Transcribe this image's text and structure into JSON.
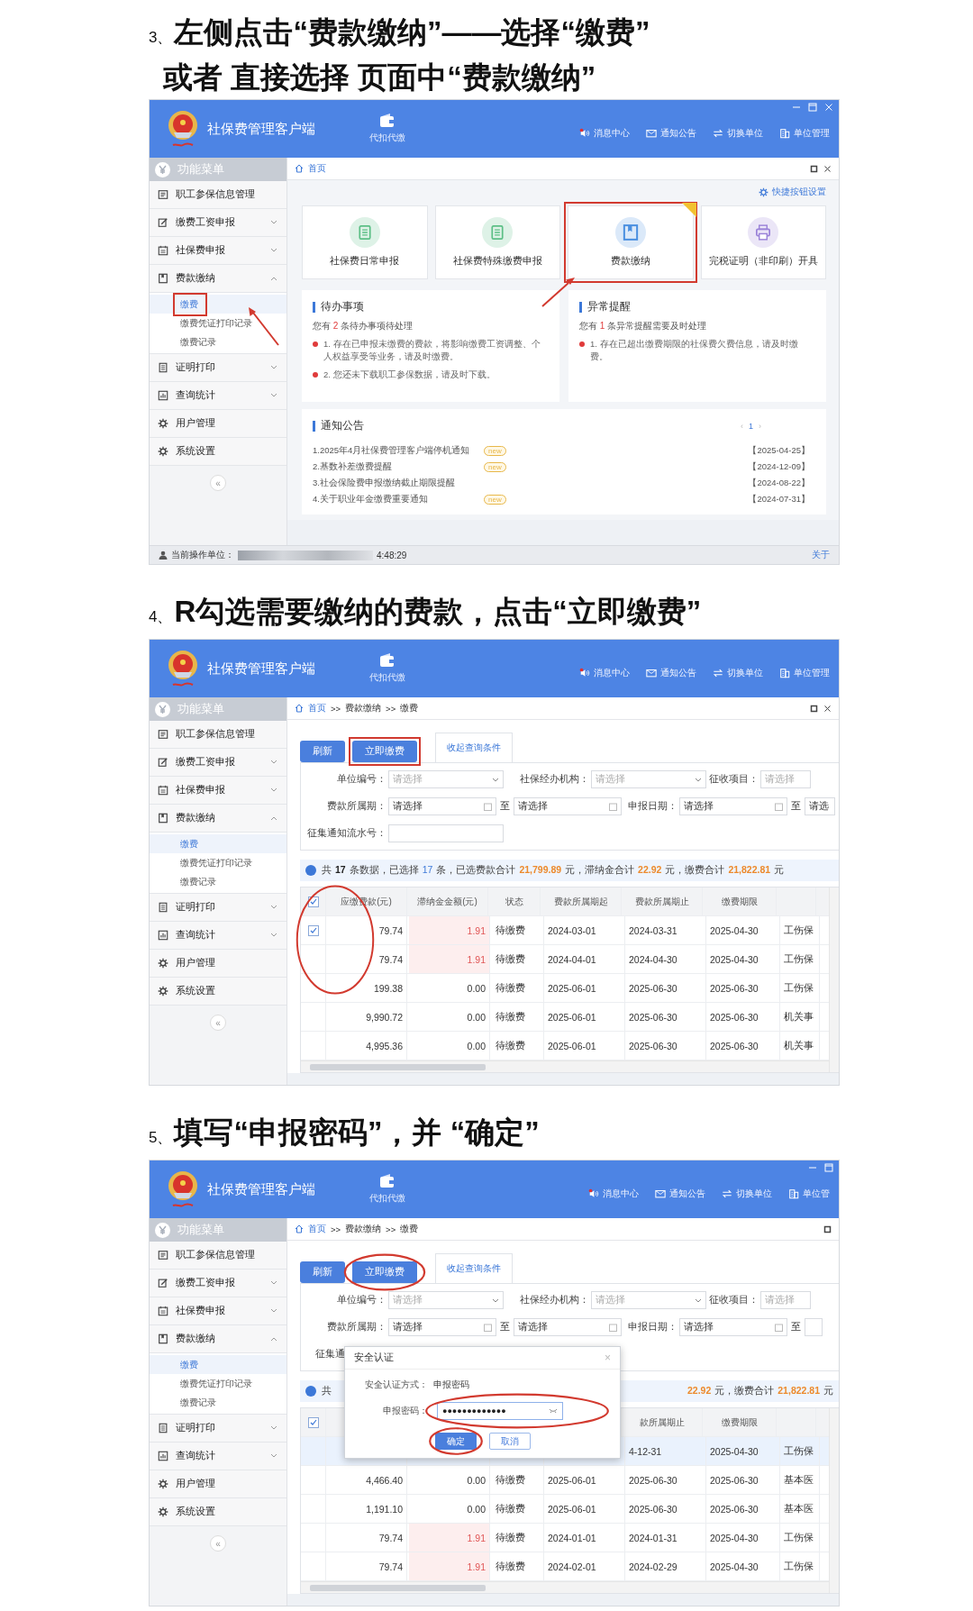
{
  "steps": [
    {
      "number": "3、",
      "lines": [
        "左侧点击“费款缴纳”——选择“缴费”",
        "或者 直接选择 页面中“费款缴纳”"
      ],
      "window": {
        "app_title": "社保费管理客户端",
        "center_tool": "代扣代缴",
        "actions": [
          "消息中心",
          "通知公告",
          "切换单位",
          "单位管理"
        ],
        "sidebar": {
          "title": "功能菜单",
          "collapse": "«",
          "items": [
            {
              "label": "职工参保信息管理"
            },
            {
              "label": "缴费工资申报",
              "expanded": false
            },
            {
              "label": "社保费申报",
              "expanded": false
            },
            {
              "label": "费款缴纳",
              "expanded": true,
              "children": [
                {
                  "label": "缴费",
                  "selected": true,
                  "highlighted": true
                },
                {
                  "label": "缴费凭证打印记录",
                  "selected": false,
                  "highlighted": false
                },
                {
                  "label": "缴费记录",
                  "selected": false,
                  "highlighted": false
                }
              ]
            },
            {
              "label": "证明打印",
              "expanded": false
            },
            {
              "label": "查询统计",
              "expanded": false
            },
            {
              "label": "用户管理"
            },
            {
              "label": "系统设置"
            }
          ]
        },
        "breadcrumb": {
          "items": [
            "首页"
          ]
        },
        "page": {
          "kind": "home",
          "quick_setting": "快捷按钮设置",
          "tiles": [
            {
              "label": "社保费日常申报",
              "highlighted": false,
              "corner_tag": false
            },
            {
              "label": "社保费特殊缴费申报",
              "highlighted": false,
              "corner_tag": false
            },
            {
              "label": "费款缴纳",
              "highlighted": true,
              "corner_tag": true
            },
            {
              "label": "完税证明（非印刷）开具",
              "highlighted": false,
              "corner_tag": false
            }
          ],
          "cards": [
            {
              "title": "待办事项",
              "summary": [
                "您有",
                "2",
                "条待办事项待处理"
              ],
              "items": [
                "1. 存在已申报未缴费的费款，将影响缴费工资调整、个人权益享受等业务，请及时缴费。",
                "2. 您还未下载职工参保数据，请及时下载。"
              ]
            },
            {
              "title": "异常提醒",
              "summary": [
                "您有",
                "1",
                "条异常提醒需要及时处理"
              ],
              "items": [
                "1. 存在已超出缴费期限的社保费欠费信息，请及时缴费。"
              ]
            }
          ],
          "notices": {
            "title": "通知公告",
            "pager": [
              "‹",
              "1",
              "›"
            ],
            "items": [
              {
                "title": "1.2025年4月社保费管理客户端停机通知",
                "badge": "new",
                "date": "【2025-04-25】"
              },
              {
                "title": "2.基数补差缴费提醒",
                "badge": "new",
                "date": "【2024-12-09】"
              },
              {
                "title": "3.社会保险费申报缴纳截止期限提醒",
                "date": "【2024-08-22】"
              },
              {
                "title": "4.关于职业年金缴费重要通知",
                "badge": "new",
                "date": "【2024-07-31】"
              }
            ]
          }
        },
        "status_bar": {
          "label": "当前操作单位：",
          "time": "4:48:29",
          "link": "关于"
        }
      }
    },
    {
      "number": "4、",
      "lines": [
        "R勾选需要缴纳的费款，点击“立即缴费”"
      ],
      "window": {
        "app_title": "社保费管理客户端",
        "center_tool": "代扣代缴",
        "actions": [
          "消息中心",
          "通知公告",
          "切换单位",
          "单位管理"
        ],
        "sidebar": {
          "title": "功能菜单",
          "collapse": "«",
          "items": [
            {
              "label": "职工参保信息管理"
            },
            {
              "label": "缴费工资申报",
              "expanded": false
            },
            {
              "label": "社保费申报",
              "expanded": false
            },
            {
              "label": "费款缴纳",
              "expanded": true,
              "children": [
                {
                  "label": "缴费",
                  "selected": true,
                  "highlighted": false
                },
                {
                  "label": "缴费凭证打印记录",
                  "selected": false,
                  "highlighted": false
                },
                {
                  "label": "缴费记录",
                  "selected": false,
                  "highlighted": false
                }
              ]
            },
            {
              "label": "证明打印",
              "expanded": false
            },
            {
              "label": "查询统计",
              "expanded": false
            },
            {
              "label": "用户管理"
            },
            {
              "label": "系统设置"
            }
          ]
        },
        "breadcrumb": {
          "items": [
            "首页",
            "费款缴纳",
            "缴费"
          ],
          "separator": ">>"
        },
        "page": {
          "kind": "payment",
          "buttons": [
            {
              "label": "刷新",
              "highlighted": false,
              "circled": false
            },
            {
              "label": "立即缴费",
              "highlighted": true,
              "circled": false
            }
          ],
          "filter_tab": "收起查询条件",
          "filters": [
            [
              {
                "kind": "select",
                "label": "单位编号：",
                "placeholder": "请选择"
              },
              {
                "kind": "select",
                "label": "社保经办机构：",
                "placeholder": "请选择"
              },
              {
                "kind": "select",
                "label": "征收项目：",
                "placeholder": "请选择"
              }
            ],
            [
              {
                "kind": "date_range",
                "label": "费款所属期：",
                "from": "请选择",
                "joiner": "至",
                "to": "请选择"
              },
              {
                "kind": "date_range",
                "label": "申报日期：",
                "from": "请选择",
                "joiner": "至",
                "to": "请选"
              }
            ],
            [
              {
                "kind": "text",
                "label": "征集通知流水号："
              }
            ]
          ],
          "summary": {
            "left": [
              {
                "text": "共"
              },
              {
                "text": "17",
                "kind": "count"
              },
              {
                "text": "条数据，已选择"
              },
              {
                "text": "17",
                "kind": "selected"
              },
              {
                "text": "条，已选费款合计"
              },
              {
                "text": "21,799.89",
                "kind": "amount"
              },
              {
                "text": "元，滞纳金合计"
              },
              {
                "text": "22.92",
                "kind": "amount"
              },
              {
                "text": "元，缴费合计"
              },
              {
                "text": "21,822.81",
                "kind": "amount"
              },
              {
                "text": "元"
              }
            ]
          },
          "table": {
            "circled": true,
            "header_checked": true,
            "columns": [
              "应缴费款(元)",
              "滞纳金金额(元)",
              "状态",
              "费款所属期起",
              "费款所属期止",
              "缴费期限"
            ],
            "rows": [
              {
                "checked": true,
                "overdue": true,
                "cells": [
                  "79.74",
                  "1.91",
                  "待缴费",
                  "2024-03-01",
                  "2024-03-31",
                  "2025-04-30",
                  "工伤保"
                ]
              },
              {
                "overdue": true,
                "cells": [
                  "79.74",
                  "1.91",
                  "待缴费",
                  "2024-04-01",
                  "2024-04-30",
                  "2025-04-30",
                  "工伤保"
                ]
              },
              {
                "overdue": false,
                "cells": [
                  "199.38",
                  "0.00",
                  "待缴费",
                  "2025-06-01",
                  "2025-06-30",
                  "2025-06-30",
                  "工伤保"
                ]
              },
              {
                "overdue": false,
                "cells": [
                  "9,990.72",
                  "0.00",
                  "待缴费",
                  "2025-06-01",
                  "2025-06-30",
                  "2025-06-30",
                  "机关事"
                ]
              },
              {
                "overdue": false,
                "cells": [
                  "4,995.36",
                  "0.00",
                  "待缴费",
                  "2025-06-01",
                  "2025-06-30",
                  "2025-06-30",
                  "机关事"
                ]
              }
            ]
          }
        }
      }
    },
    {
      "number": "5、",
      "lines": [
        "填写“申报密码”，并 “确定”"
      ],
      "window": {
        "app_title": "社保费管理客户端",
        "center_tool": "代扣代缴",
        "actions": [
          "消息中心",
          "通知公告",
          "切换单位",
          "单位管"
        ],
        "sidebar": {
          "title": "功能菜单",
          "collapse": "«",
          "items": [
            {
              "label": "职工参保信息管理"
            },
            {
              "label": "缴费工资申报",
              "expanded": false
            },
            {
              "label": "社保费申报",
              "expanded": false
            },
            {
              "label": "费款缴纳",
              "expanded": true,
              "children": [
                {
                  "label": "缴费",
                  "selected": true,
                  "highlighted": false
                },
                {
                  "label": "缴费凭证打印记录",
                  "selected": false,
                  "highlighted": false
                },
                {
                  "label": "缴费记录",
                  "selected": false,
                  "highlighted": false
                }
              ]
            },
            {
              "label": "证明打印",
              "expanded": false
            },
            {
              "label": "查询统计",
              "expanded": false
            },
            {
              "label": "用户管理"
            },
            {
              "label": "系统设置"
            }
          ]
        },
        "breadcrumb": {
          "items": [
            "首页",
            "费款缴纳",
            "缴费"
          ],
          "separator": ">>"
        },
        "page": {
          "kind": "payment",
          "buttons": [
            {
              "label": "刷新",
              "highlighted": false,
              "circled": false
            },
            {
              "label": "立即缴费",
              "highlighted": false,
              "circled": true
            }
          ],
          "filter_tab": "收起查询条件",
          "filters": [
            [
              {
                "kind": "select",
                "label": "单位编号：",
                "placeholder": "请选择"
              },
              {
                "kind": "select",
                "label": "社保经办机构：",
                "placeholder": "请选择"
              },
              {
                "kind": "select",
                "label": "征收项目：",
                "placeholder": "请选择"
              }
            ],
            [
              {
                "kind": "date_range",
                "label": "费款所属期：",
                "from": "请选择",
                "joiner": "至",
                "to": "请选择"
              },
              {
                "kind": "date_range",
                "label": "申报日期：",
                "from": "请选择",
                "joiner": "至"
              }
            ],
            [
              {
                "kind": "label",
                "label": "征集通"
              }
            ]
          ],
          "summary": {
            "left": [
              {
                "text": "共"
              }
            ],
            "right": [
              {
                "text": "22.92",
                "kind": "amount"
              },
              {
                "text": "元，缴费合计"
              },
              {
                "text": "21,822.81",
                "kind": "amount"
              },
              {
                "text": "元"
              }
            ]
          },
          "table": {
            "circled": false,
            "header_checked": true,
            "columns": [
              null,
              null,
              null,
              null,
              "款所属期止",
              "缴费期限"
            ],
            "rows": [
              {
                "selected": true,
                "cells": [
                  null,
                  null,
                  null,
                  null,
                  "4-12-31",
                  "2025-04-30",
                  "工伤保"
                ]
              },
              {
                "selected": false,
                "overdue": false,
                "cells": [
                  "4,466.40",
                  "0.00",
                  "待缴费",
                  "2025-06-01",
                  "2025-06-30",
                  "2025-06-30",
                  "基本医"
                ]
              },
              {
                "selected": false,
                "overdue": false,
                "cells": [
                  "1,191.10",
                  "0.00",
                  "待缴费",
                  "2025-06-01",
                  "2025-06-30",
                  "2025-06-30",
                  "基本医"
                ]
              },
              {
                "selected": false,
                "overdue": true,
                "cells": [
                  "79.74",
                  "1.91",
                  "待缴费",
                  "2024-01-01",
                  "2024-01-31",
                  "2025-04-30",
                  "工伤保"
                ]
              },
              {
                "selected": false,
                "overdue": true,
                "cells": [
                  "79.74",
                  "1.91",
                  "待缴费",
                  "2024-02-01",
                  "2024-02-29",
                  "2025-04-30",
                  "工伤保"
                ]
              }
            ]
          },
          "dialog": {
            "title": "安全认证",
            "close": "×",
            "method_label": "安全认证方式：",
            "method_value": "申报密码",
            "password_label": "申报密码：",
            "password_value": "●●●●●●●●●●●●●",
            "password_circled": true,
            "buttons": [
              {
                "label": "确定",
                "kind": "primary",
                "circled": true
              },
              {
                "label": "取消",
                "kind": "secondary",
                "circled": false
              }
            ]
          }
        }
      }
    }
  ]
}
